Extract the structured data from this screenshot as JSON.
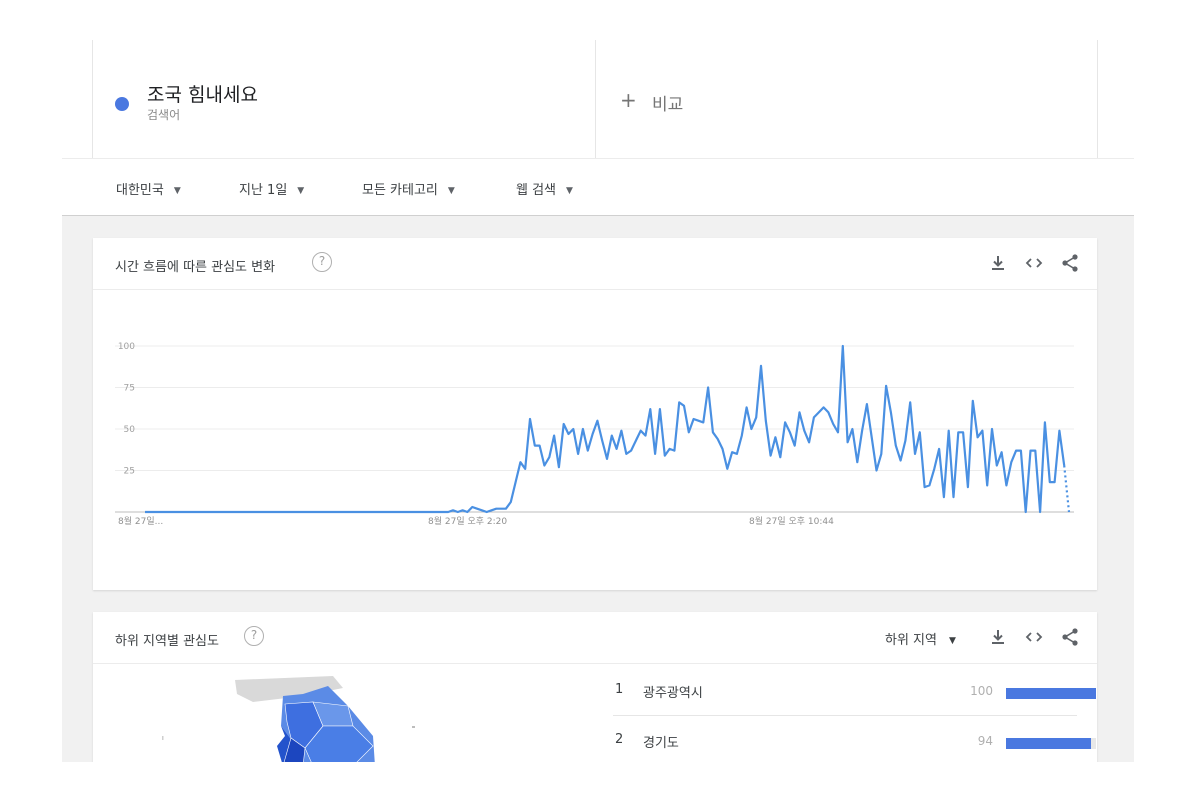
{
  "search": {
    "term": "조국 힘내세요",
    "term_type": "검색어",
    "term_color": "#4a78e0",
    "compare_icon": "plus-icon",
    "compare_label": "비교"
  },
  "filters": [
    {
      "label": "대한민국"
    },
    {
      "label": "지난 1일"
    },
    {
      "label": "모든 카테고리"
    },
    {
      "label": "웹 검색"
    }
  ],
  "interest_over_time": {
    "title": "시간 흐름에 따른 관심도 변화",
    "help_icon": "help-icon",
    "actions": [
      "download-icon",
      "embed-icon",
      "share-icon"
    ]
  },
  "chart_data": {
    "type": "line",
    "series": [
      {
        "color": "#4a90e2",
        "values": [
          0,
          0,
          0,
          0,
          0,
          0,
          0,
          0,
          0,
          0,
          0,
          0,
          0,
          0,
          0,
          0,
          0,
          0,
          0,
          0,
          0,
          0,
          0,
          0,
          0,
          0,
          0,
          0,
          0,
          0,
          0,
          0,
          0,
          0,
          0,
          0,
          0,
          0,
          0,
          0,
          0,
          0,
          0,
          0,
          0,
          0,
          0,
          0,
          0,
          0,
          0,
          0,
          0,
          0,
          0,
          0,
          0,
          0,
          0,
          0,
          0,
          0,
          0,
          0,
          1,
          0,
          1,
          0,
          3,
          2,
          1,
          0,
          1,
          2,
          2,
          2,
          6,
          18,
          30,
          26,
          56,
          40,
          40,
          28,
          33,
          46,
          27,
          53,
          47,
          50,
          35,
          50,
          37,
          47,
          55,
          43,
          32,
          46,
          38,
          49,
          35,
          37,
          43,
          49,
          46,
          62,
          35,
          62,
          34,
          38,
          37,
          66,
          64,
          48,
          56,
          55,
          54,
          75,
          48,
          44,
          38,
          26,
          36,
          35,
          46,
          63,
          50,
          57,
          88,
          55,
          34,
          45,
          33,
          54,
          48,
          40,
          60,
          49,
          42,
          57,
          60,
          63,
          60,
          53,
          48,
          100,
          42,
          50,
          30,
          49,
          65,
          45,
          25,
          35,
          76,
          60,
          40,
          31,
          43,
          66,
          35,
          48,
          15,
          16,
          26,
          38,
          9,
          49,
          9,
          48,
          48,
          15,
          67,
          45,
          49,
          16,
          50,
          28,
          36,
          16,
          30,
          37,
          37,
          0,
          37,
          37,
          0,
          54,
          18,
          18,
          49,
          28,
          0
        ],
        "projected_last": true
      }
    ],
    "x_tick_labels": [
      "8월 27일...",
      "8월 27일 오후 2:20",
      "8월 27일 오후 10:44"
    ],
    "y_ticks": [
      100,
      75,
      50,
      25
    ],
    "ylim": [
      0,
      100
    ],
    "grid": true
  },
  "regions": {
    "title": "하위 지역별 관심도",
    "help_icon": "help-icon",
    "select_label": "하위 지역",
    "actions": [
      "download-icon",
      "embed-icon",
      "share-icon"
    ],
    "bar_color": "#4a78e0",
    "items": [
      {
        "rank": "1",
        "name": "광주광역시",
        "value": "100",
        "fraction": 1.0
      },
      {
        "rank": "2",
        "name": "경기도",
        "value": "94",
        "fraction": 0.94
      }
    ]
  }
}
